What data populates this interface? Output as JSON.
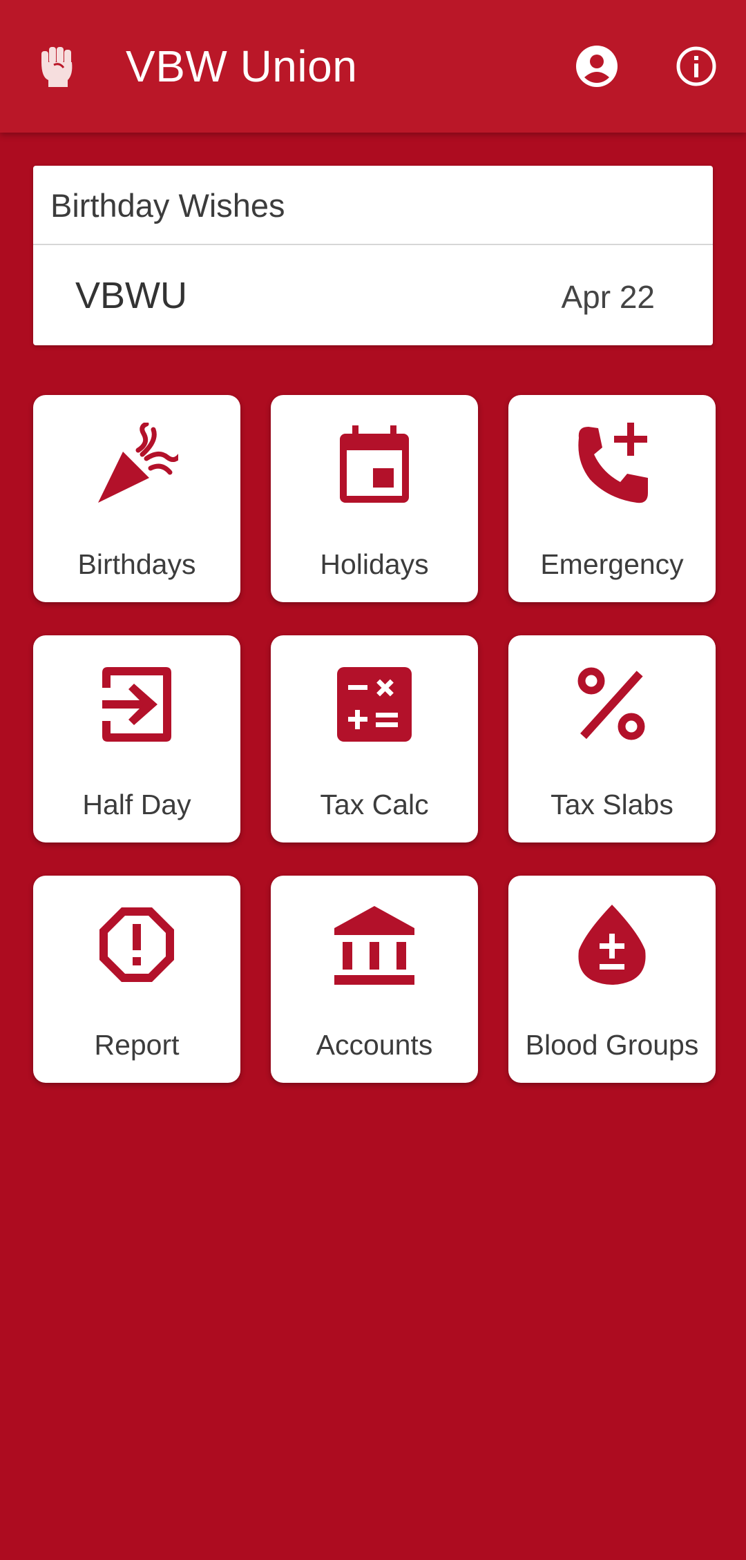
{
  "appbar": {
    "title": "VBW Union",
    "logo_icon": "raised-fist-icon",
    "actions": [
      "account-icon",
      "info-icon"
    ]
  },
  "wishes": {
    "header": "Birthday Wishes",
    "entries": [
      {
        "name": "VBWU",
        "date": "Apr 22"
      }
    ]
  },
  "tiles": [
    {
      "label": "Birthdays",
      "icon": "party-popper-icon"
    },
    {
      "label": "Holidays",
      "icon": "calendar-icon"
    },
    {
      "label": "Emergency",
      "icon": "phone-add-icon"
    },
    {
      "label": "Half Day",
      "icon": "login-arrow-icon"
    },
    {
      "label": "Tax Calc",
      "icon": "calculator-icon"
    },
    {
      "label": "Tax Slabs",
      "icon": "percent-icon"
    },
    {
      "label": "Report",
      "icon": "report-octagon-icon"
    },
    {
      "label": "Accounts",
      "icon": "bank-icon"
    },
    {
      "label": "Blood Groups",
      "icon": "blood-drop-icon"
    }
  ],
  "colors": {
    "background": "#ad0c20",
    "appbar": "#ba1728",
    "accent": "#b3112a",
    "card": "#ffffff"
  }
}
